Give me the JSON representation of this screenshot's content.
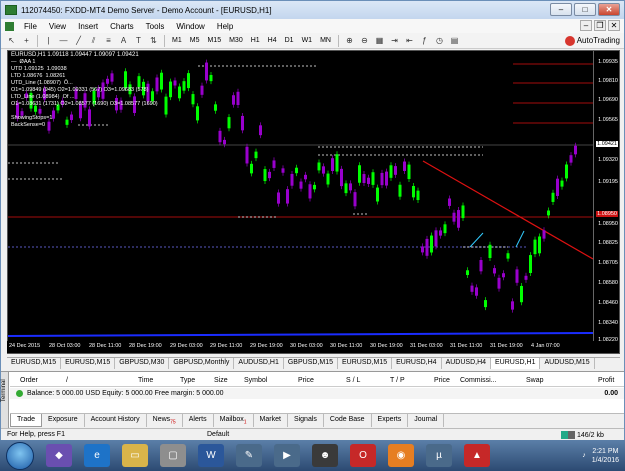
{
  "window": {
    "title": "112074450: FXDD-MT4 Demo Server - Demo Account - [EURUSD,H1]",
    "buttons": [
      "–",
      "□",
      "✕"
    ]
  },
  "menu": [
    "File",
    "View",
    "Insert",
    "Charts",
    "Tools",
    "Window",
    "Help"
  ],
  "toolbar": {
    "timeframes": [
      "M1",
      "M5",
      "M15",
      "M30",
      "H1",
      "H4",
      "D1",
      "W1",
      "MN"
    ],
    "autotrading_label": "AutoTrading"
  },
  "chart": {
    "symbol_line": "EURUSD,H1  1.09118 1.09447 1.09097 1.09421",
    "overlay_text": "—  ØAA 1\nUTD 1.09125  1.09038\nLTD 1.08676  1.08261\nUTD_Line (1.08907)  Ô... \nO1=1.09849 (945) O2=1.09331 (567) O3=1.09683 (578)\nLTD_Line (1.08984)  Of ...\nO1=1.08631 (1731) O2=1.08577 (1690) O3=1.08577 (1690)\n\nShowingStops=1\nBackSense=0",
    "price_labels": [
      "1.09935",
      "1.09810",
      "1.09690",
      "1.09565",
      "1.09421",
      "1.09320",
      "1.09195",
      "1.09070",
      "1.08950",
      "1.08825",
      "1.08705",
      "1.08580",
      "1.08460",
      "1.08340",
      "1.08220"
    ],
    "current_price": "1.09421",
    "red_price": "1.08950",
    "time_labels": [
      "24 Dec 2015",
      "28 Oct 03:00",
      "28 Dec 11:00",
      "28 Dec 19:00",
      "29 Dec 03:00",
      "29 Dec 11:00",
      "29 Dec 19:00",
      "30 Dec 03:00",
      "30 Dec 11:00",
      "30 Dec 19:00",
      "31 Dec 03:00",
      "31 Dec 11:00",
      "31 Dec 19:00",
      "4 Jan 07:00"
    ]
  },
  "symbol_tabs": [
    "EURUSD,M15",
    "EURUSD,M15",
    "GBPUSD,M30",
    "GBPUSD,Monthly",
    "AUDUSD,H1",
    "GBPUSD,M15",
    "EURUSD,M15",
    "EURUSD,H4",
    "AUDUSD,H4",
    "EURUSD,H1",
    "AUDUSD,M15"
  ],
  "terminal": {
    "side_label": "Terminal",
    "columns": [
      "Order",
      "/",
      "Time",
      "Type",
      "Size",
      "Symbol",
      "Price",
      "S / L",
      "T / P",
      "Price",
      "Commissi...",
      "Swap",
      "Profit"
    ],
    "balance_text": "Balance: 5 000.00 USD  Equity: 5 000.00  Free margin: 5 000.00",
    "balance_profit": "0.00",
    "tabs": [
      {
        "label": "Trade",
        "badge": ""
      },
      {
        "label": "Exposure",
        "badge": ""
      },
      {
        "label": "Account History",
        "badge": ""
      },
      {
        "label": "News",
        "badge": "75"
      },
      {
        "label": "Alerts",
        "badge": ""
      },
      {
        "label": "Mailbox",
        "badge": "1"
      },
      {
        "label": "Market",
        "badge": ""
      },
      {
        "label": "Signals",
        "badge": ""
      },
      {
        "label": "Code Base",
        "badge": ""
      },
      {
        "label": "Experts",
        "badge": ""
      },
      {
        "label": "Journal",
        "badge": ""
      }
    ]
  },
  "statusbar": {
    "help": "For Help, press F1",
    "profile": "Default",
    "traffic": "146/2 kb"
  },
  "taskbar": {
    "time": "2:21 PM",
    "date": "1/4/2016"
  },
  "colors": {
    "bull": "#00ff00",
    "bear": "#9900cc",
    "red_line": "#dd1111",
    "blue_line": "#1a2cff",
    "support_dots": "#7777ff"
  }
}
